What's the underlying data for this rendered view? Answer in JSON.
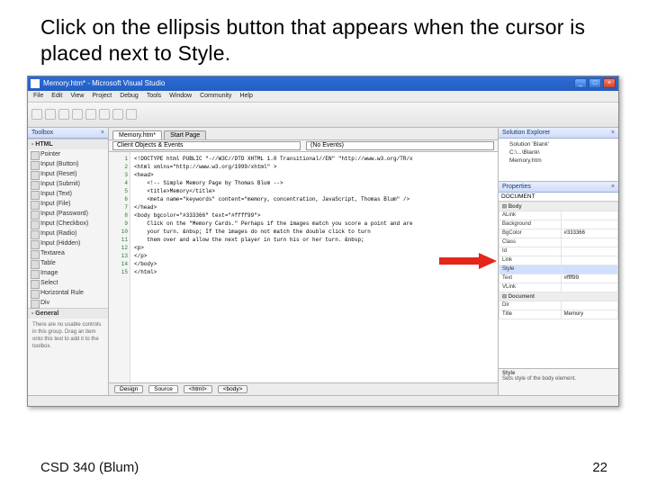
{
  "instruction": "Click on the ellipsis button that appears when the cursor is placed next to Style.",
  "footer": {
    "left": "CSD 340 (Blum)",
    "right": "22"
  },
  "titlebar": {
    "title": "Memory.htm* - Microsoft Visual Studio",
    "min": "_",
    "max": "□",
    "close": "×"
  },
  "menubar": [
    "File",
    "Edit",
    "View",
    "Project",
    "Debug",
    "Tools",
    "Window",
    "Community",
    "Help"
  ],
  "doctabs": [
    "Memory.htm*",
    "Start Page"
  ],
  "eltbar": {
    "left": "Client Objects & Events",
    "right": "(No Events)"
  },
  "panels": {
    "toolbox": "Toolbox",
    "solexp": "Solution Explorer",
    "props": "Properties"
  },
  "toolbox": {
    "groups": [
      {
        "label": "- HTML",
        "items": [
          "Pointer",
          "Input (Button)",
          "Input (Reset)",
          "Input (Submit)",
          "Input (Text)",
          "Input (File)",
          "Input (Password)",
          "Input (Checkbox)",
          "Input (Radio)",
          "Input (Hidden)",
          "Textarea",
          "Table",
          "Image",
          "Select",
          "Horizontal Rule",
          "Div"
        ]
      },
      {
        "label": "- General",
        "items": []
      }
    ],
    "emptymsg": "There are no usable controls in this group. Drag an item onto this text to add it to the toolbox."
  },
  "code": {
    "lines": [
      "<!DOCTYPE html PUBLIC \"-//W3C//DTD XHTML 1.0 Transitional//EN\" \"http://www.w3.org/TR/x",
      "<html xmlns=\"http://www.w3.org/1999/xhtml\" >",
      "<head>",
      "    <!-- Simple Memory Page by Thomas Blum -->",
      "    <title>Memory</title>",
      "    <meta name=\"keywords\" content=\"memory, concentration, JavaScript, Thomas Blum\" />",
      "</head>",
      "<body bgcolor=\"#333366\" text=\"#ffff99\">",
      "    Click on the \"Memory Cards.\" Perhaps if the images match you score a point and are",
      "    your turn. &nbsp; If the images do not match the double click to turn",
      "    them over and allow the next player in turn his or her turn. &nbsp;",
      "<p>",
      "</p>",
      "</body>",
      "</html>"
    ],
    "numbers": [
      "1",
      "2",
      "3",
      "4",
      "5",
      "6",
      "7",
      "8",
      "9",
      "10",
      "11",
      "12",
      "13",
      "14",
      "15"
    ]
  },
  "viewtabs": {
    "design": "Design",
    "source": "Source",
    "path": [
      "<html>",
      "<body>"
    ]
  },
  "solexp": {
    "items": [
      "Solution 'Blank'",
      "  C:\\...\\Blank\\",
      "    Memory.htm"
    ]
  },
  "props": {
    "selector": "DOCUMENT",
    "rows": [
      {
        "cat": "Body",
        "type": "cat"
      },
      {
        "n": "ALink",
        "v": ""
      },
      {
        "n": "Background",
        "v": ""
      },
      {
        "n": "BgColor",
        "v": "#333366"
      },
      {
        "n": "Class",
        "v": ""
      },
      {
        "n": "Id",
        "v": ""
      },
      {
        "n": "Link",
        "v": ""
      },
      {
        "n": "Style",
        "v": "",
        "hi": true
      },
      {
        "n": "Text",
        "v": "#ffff99"
      },
      {
        "n": "VLink",
        "v": ""
      },
      {
        "cat": "Document",
        "type": "cat"
      },
      {
        "n": "Dir",
        "v": ""
      },
      {
        "n": "Title",
        "v": "Memory"
      }
    ],
    "desc": {
      "n": "Style",
      "t": "Sets style of the body element."
    }
  }
}
